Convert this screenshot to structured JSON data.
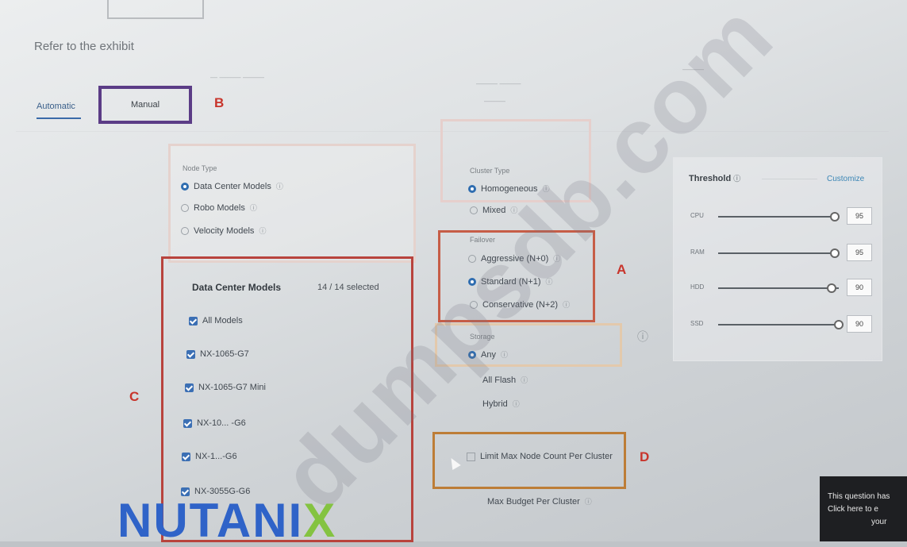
{
  "header": {
    "exhibit_text": "Refer to the exhibit"
  },
  "tabs": [
    {
      "label": "Automatic",
      "active": true
    },
    {
      "label": "Manual",
      "active": false
    }
  ],
  "markers": {
    "a": "A",
    "b": "B",
    "c": "C",
    "d": "D"
  },
  "node_type": {
    "label": "Node Type",
    "options": [
      {
        "label": "Data Center Models",
        "selected": true
      },
      {
        "label": "Robo Models",
        "selected": false
      },
      {
        "label": "Velocity Models",
        "selected": false
      }
    ]
  },
  "data_center_models": {
    "title": "Data Center Models",
    "count": "14 / 14 selected",
    "items": [
      {
        "label": "All Models",
        "checked": true
      },
      {
        "label": "NX-1065-G7",
        "checked": true
      },
      {
        "label": "NX-1065-G7 Mini",
        "checked": true
      },
      {
        "label": "NX-10... -G6",
        "checked": true
      },
      {
        "label": "NX-1...-G6",
        "checked": true
      },
      {
        "label": "NX-3055G-G6",
        "checked": true
      }
    ]
  },
  "cluster_type": {
    "label": "Cluster Type",
    "options": [
      {
        "label": "Homogeneous",
        "selected": true
      },
      {
        "label": "Mixed",
        "selected": false
      }
    ]
  },
  "failover": {
    "label": "Failover",
    "options": [
      {
        "label": "Aggressive (N+0)",
        "selected": false
      },
      {
        "label": "Standard (N+1)",
        "selected": true
      },
      {
        "label": "Conservative (N+2)",
        "selected": false
      }
    ]
  },
  "storage": {
    "label": "Storage",
    "options": [
      {
        "label": "Any",
        "selected": true
      },
      {
        "label": "All Flash",
        "selected": false
      },
      {
        "label": "Hybrid",
        "selected": false
      }
    ]
  },
  "limits": {
    "max_node_label": "Limit Max Node Count Per Cluster",
    "max_budget_label": "Max Budget Per Cluster"
  },
  "threshold": {
    "title": "Threshold",
    "customize_label": "Customize",
    "sliders": [
      {
        "label": "CPU",
        "value": "95",
        "fraction": 0.97
      },
      {
        "label": "RAM",
        "value": "95",
        "fraction": 0.97
      },
      {
        "label": "HDD",
        "value": "90",
        "fraction": 0.94
      },
      {
        "label": "SSD",
        "value": "90",
        "fraction": 1.0
      }
    ]
  },
  "watermark": "dumpsdb.com",
  "logo": {
    "text_main": "NUTANI",
    "text_accent": "X"
  },
  "tooltip": {
    "line1": "This question has",
    "line2": "Click here to e",
    "line3": "your"
  }
}
